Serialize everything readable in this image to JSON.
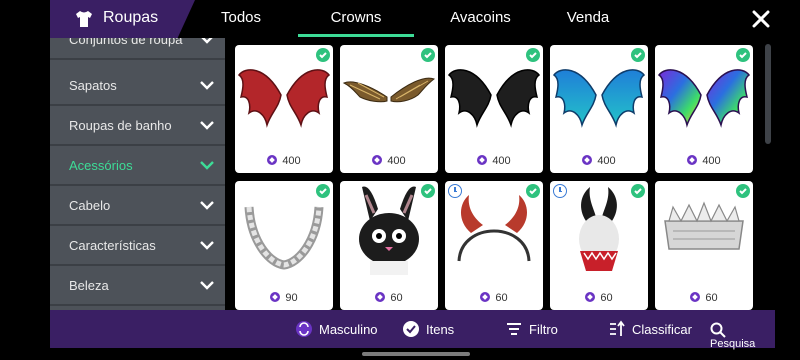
{
  "header": {
    "title": "Roupas",
    "tabs": [
      {
        "label": "Todos"
      },
      {
        "label": "Crowns"
      },
      {
        "label": "Avacoins"
      },
      {
        "label": "Venda"
      }
    ],
    "active_tab": "Crowns",
    "accent_color": "#3ddc97"
  },
  "sidebar": {
    "items": [
      {
        "label": "Conjuntos de roupa"
      },
      {
        "label": "Sapatos"
      },
      {
        "label": "Roupas de banho"
      },
      {
        "label": "Acessórios",
        "active": true
      },
      {
        "label": "Cabelo"
      },
      {
        "label": "Características"
      },
      {
        "label": "Beleza"
      }
    ]
  },
  "items": [
    {
      "name": "red-wings",
      "price": "400",
      "owned": true,
      "timed": false
    },
    {
      "name": "brown-feather-wings",
      "price": "400",
      "owned": true,
      "timed": false
    },
    {
      "name": "black-wings",
      "price": "400",
      "owned": true,
      "timed": false
    },
    {
      "name": "blue-wings",
      "price": "400",
      "owned": true,
      "timed": false
    },
    {
      "name": "rainbow-wings",
      "price": "400",
      "owned": true,
      "timed": false
    },
    {
      "name": "silver-chain",
      "price": "90",
      "owned": true,
      "timed": false
    },
    {
      "name": "black-bunny-mask",
      "price": "60",
      "owned": true,
      "timed": false
    },
    {
      "name": "red-horns-headband",
      "price": "60",
      "owned": true,
      "timed": true
    },
    {
      "name": "black-horns-mask",
      "price": "60",
      "owned": true,
      "timed": true
    },
    {
      "name": "white-crown",
      "price": "60",
      "owned": true,
      "timed": false
    }
  ],
  "bottom_bar": {
    "gender": "Masculino",
    "items": "Itens",
    "filter": "Filtro",
    "sort": "Classificar",
    "search": "Pesquisa"
  }
}
